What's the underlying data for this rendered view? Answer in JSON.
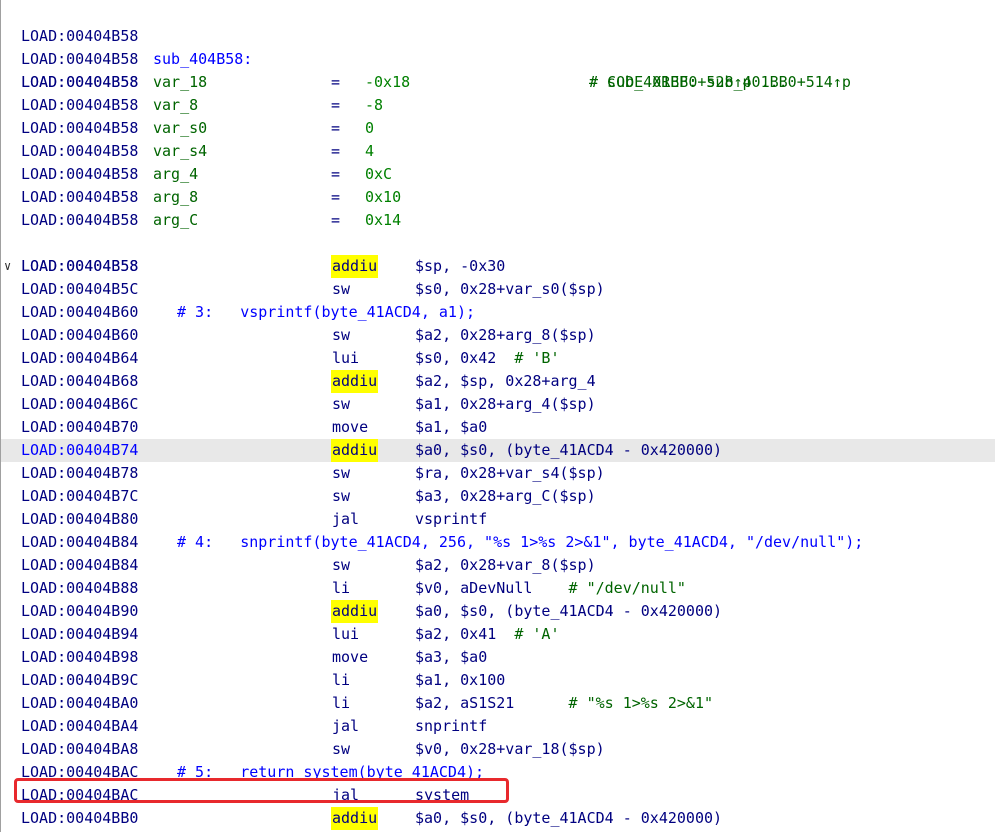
{
  "header": {
    "addr": "LOAD:00404B58",
    "func_name": "sub_404B58:",
    "xref_label": "# CODE XREF: sub_401BB0+514↑p",
    "xref_more": "# sub_401BB0+528↑p ..."
  },
  "vars": [
    {
      "addr": "LOAD:00404B58",
      "name": "var_18",
      "eq": "=",
      "value": "-0x18"
    },
    {
      "addr": "LOAD:00404B58",
      "name": "var_8",
      "eq": "=",
      "value": "-8"
    },
    {
      "addr": "LOAD:00404B58",
      "name": "var_s0",
      "eq": "=",
      "value": "0"
    },
    {
      "addr": "LOAD:00404B58",
      "name": "var_s4",
      "eq": "=",
      "value": "4"
    },
    {
      "addr": "LOAD:00404B58",
      "name": "arg_4",
      "eq": "=",
      "value": "0xC"
    },
    {
      "addr": "LOAD:00404B58",
      "name": "arg_8",
      "eq": "=",
      "value": "0x10"
    },
    {
      "addr": "LOAD:00404B58",
      "name": "arg_C",
      "eq": "=",
      "value": "0x14"
    }
  ],
  "blank_addr": "LOAD:00404B58",
  "fold_icon": "∨",
  "instructions": [
    {
      "addr": "LOAD:00404B58",
      "mn": "addiu",
      "hl": true,
      "ops": "$sp, -0x30",
      "fold": true
    },
    {
      "addr": "LOAD:00404B5C",
      "mn": "sw",
      "ops": "$s0, 0x28+var_s0($sp)"
    },
    {
      "addr": "LOAD:00404B60",
      "pseudo": "# 3:   vsprintf(byte_41ACD4, a1);"
    },
    {
      "addr": "LOAD:00404B60",
      "mn": "sw",
      "ops": "$a2, 0x28+arg_8($sp)"
    },
    {
      "addr": "LOAD:00404B64",
      "mn": "lui",
      "ops": "$s0, 0x42",
      "cmt": "  # 'B'"
    },
    {
      "addr": "LOAD:00404B68",
      "mn": "addiu",
      "hl": true,
      "ops": "$a2, $sp, 0x28+arg_4"
    },
    {
      "addr": "LOAD:00404B6C",
      "mn": "sw",
      "ops": "$a1, 0x28+arg_4($sp)"
    },
    {
      "addr": "LOAD:00404B70",
      "mn": "move",
      "ops": "$a1, $a0"
    },
    {
      "addr": "LOAD:00404B74",
      "mn": "addiu",
      "hl": true,
      "ops": "$a0, $s0, (byte_41ACD4 - 0x420000)",
      "sel": true
    },
    {
      "addr": "LOAD:00404B78",
      "mn": "sw",
      "ops": "$ra, 0x28+var_s4($sp)"
    },
    {
      "addr": "LOAD:00404B7C",
      "mn": "sw",
      "ops": "$a3, 0x28+arg_C($sp)"
    },
    {
      "addr": "LOAD:00404B80",
      "mn": "jal",
      "ops": "vsprintf"
    },
    {
      "addr": "LOAD:00404B84",
      "pseudo": "# 4:   snprintf(byte_41ACD4, 256, \"%s 1>%s 2>&1\", byte_41ACD4, \"/dev/null\");"
    },
    {
      "addr": "LOAD:00404B84",
      "mn": "sw",
      "ops": "$a2, 0x28+var_8($sp)"
    },
    {
      "addr": "LOAD:00404B88",
      "mn": "li",
      "ops": "$v0, aDevNull",
      "cmt": "    # \"/dev/null\""
    },
    {
      "addr": "LOAD:00404B90",
      "mn": "addiu",
      "hl": true,
      "ops": "$a0, $s0, (byte_41ACD4 - 0x420000)"
    },
    {
      "addr": "LOAD:00404B94",
      "mn": "lui",
      "ops": "$a2, 0x41",
      "cmt": "  # 'A'"
    },
    {
      "addr": "LOAD:00404B98",
      "mn": "move",
      "ops": "$a3, $a0"
    },
    {
      "addr": "LOAD:00404B9C",
      "mn": "li",
      "ops": "$a1, 0x100"
    },
    {
      "addr": "LOAD:00404BA0",
      "mn": "li",
      "ops": "$a2, aS1S21",
      "cmt": "      # \"%s 1>%s 2>&1\""
    },
    {
      "addr": "LOAD:00404BA4",
      "mn": "jal",
      "ops": "snprintf"
    },
    {
      "addr": "LOAD:00404BA8",
      "mn": "sw",
      "ops": "$v0, 0x28+var_18($sp)"
    },
    {
      "addr": "LOAD:00404BAC",
      "pseudo": "# 5:   return system(byte_41ACD4);"
    },
    {
      "addr": "LOAD:00404BAC",
      "mn": "jal",
      "ops": "system",
      "boxed": true
    },
    {
      "addr": "LOAD:00404BB0",
      "mn": "addiu",
      "hl": true,
      "ops": "$a0, $s0, (byte_41ACD4 - 0x420000)"
    }
  ]
}
